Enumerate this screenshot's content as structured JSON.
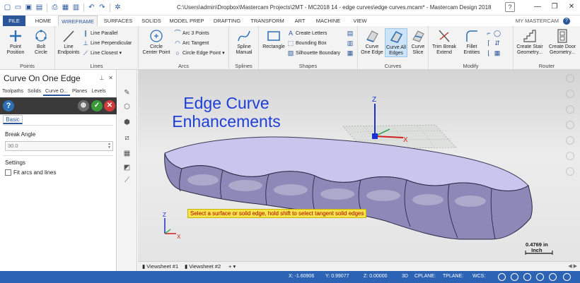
{
  "window": {
    "title": "C:\\Users\\admin\\Dropbox\\Mastercam Projects\\2MT - MC2018 14 - edge curves\\edge curves.mcam* - Mastercam Design 2018",
    "help": "?",
    "minimize": "—",
    "restore": "❐",
    "close": "✕"
  },
  "quick_access": [
    "new-icon",
    "open-icon",
    "save-icon",
    "save-as-icon",
    "print-icon",
    "print-preview-icon",
    "open-recent-icon",
    "undo-icon",
    "redo-icon",
    "customize-icon"
  ],
  "tabs": [
    {
      "label": "FILE"
    },
    {
      "label": "HOME"
    },
    {
      "label": "WIREFRAME"
    },
    {
      "label": "SURFACES"
    },
    {
      "label": "SOLIDS"
    },
    {
      "label": "MODEL PREP"
    },
    {
      "label": "DRAFTING"
    },
    {
      "label": "TRANSFORM"
    },
    {
      "label": "ART"
    },
    {
      "label": "MACHINE"
    },
    {
      "label": "VIEW"
    }
  ],
  "my_mastercam": "MY MASTERCAM",
  "ribbon": {
    "points": {
      "label": "Points",
      "point_position": "Point\nPosition",
      "bolt_circle": "Bolt\nCircle"
    },
    "lines": {
      "label": "Lines",
      "line_endpoints": "Line\nEndpoints",
      "line_parallel": "Line Parallel",
      "line_perpendicular": "Line Perpendicular",
      "line_closest": "Line Closest"
    },
    "arcs": {
      "label": "Arcs",
      "circle_center_point": "Circle\nCenter Point",
      "arc_3_points": "Arc 3 Points",
      "arc_tangent": "Arc Tangent",
      "circle_edge_point": "Circle Edge Point"
    },
    "splines": {
      "label": "Splines",
      "spline_manual": "Spline\nManual"
    },
    "shapes": {
      "label": "Shapes",
      "rectangle": "Rectangle",
      "create_letters": "Create Letters",
      "bounding_box": "Bounding Box",
      "silhouette_boundary": "Silhouette Boundary"
    },
    "curves": {
      "label": "Curves",
      "curve_one_edge": "Curve\nOne Edge",
      "curve_all_edges": "Curve All\nEdges",
      "curve_slice": "Curve\nSlice"
    },
    "modify": {
      "label": "Modify",
      "trim_break_extend": "Trim Break\nExtend",
      "fillet_entities": "Fillet\nEntities"
    },
    "router": {
      "label": "Router",
      "create_stair_geometry": "Create Stair\nGeometry...",
      "create_door_geometry": "Create Door\nGeometry..."
    }
  },
  "panel": {
    "title": "Curve On One Edge",
    "manager_tabs": [
      "Toolpaths",
      "Solids",
      "Curve O...",
      "Planes",
      "Levels"
    ],
    "basic_tab": "Basic",
    "break_angle_label": "Break Angle",
    "break_angle_value": "30.0",
    "settings_label": "Settings",
    "fit_arcs_label": "Fit arcs and lines",
    "fit_arcs_checked": false
  },
  "viewport": {
    "heading_line1": "Edge Curve",
    "heading_line2": "Enhancements",
    "instruction": "Select a surface or solid edge, hold shift to select tangent solid edges",
    "scale_value": "0.4769 in",
    "scale_unit": "Inch",
    "triad_z": "Z",
    "triad_x": "X",
    "gnomon_z": "Z",
    "gnomon_x": "X"
  },
  "viewsheets": [
    "Viewsheet #1",
    "Viewsheet #2"
  ],
  "status": {
    "x_label": "X:",
    "x_value": "-1.60906",
    "y_label": "Y:",
    "y_value": "0.99077",
    "z_label": "Z:",
    "z_value": "0.00000",
    "mode": "3D",
    "cplane": "CPLANE:",
    "tplane": "TPLANE:",
    "wcs": "WCS:"
  },
  "colors": {
    "accent": "#2b579a",
    "status_bar": "#2d63b4",
    "heading": "#1e3ed8",
    "part_face": "#b8b4de",
    "instruction_bg": "#f6e44a"
  }
}
